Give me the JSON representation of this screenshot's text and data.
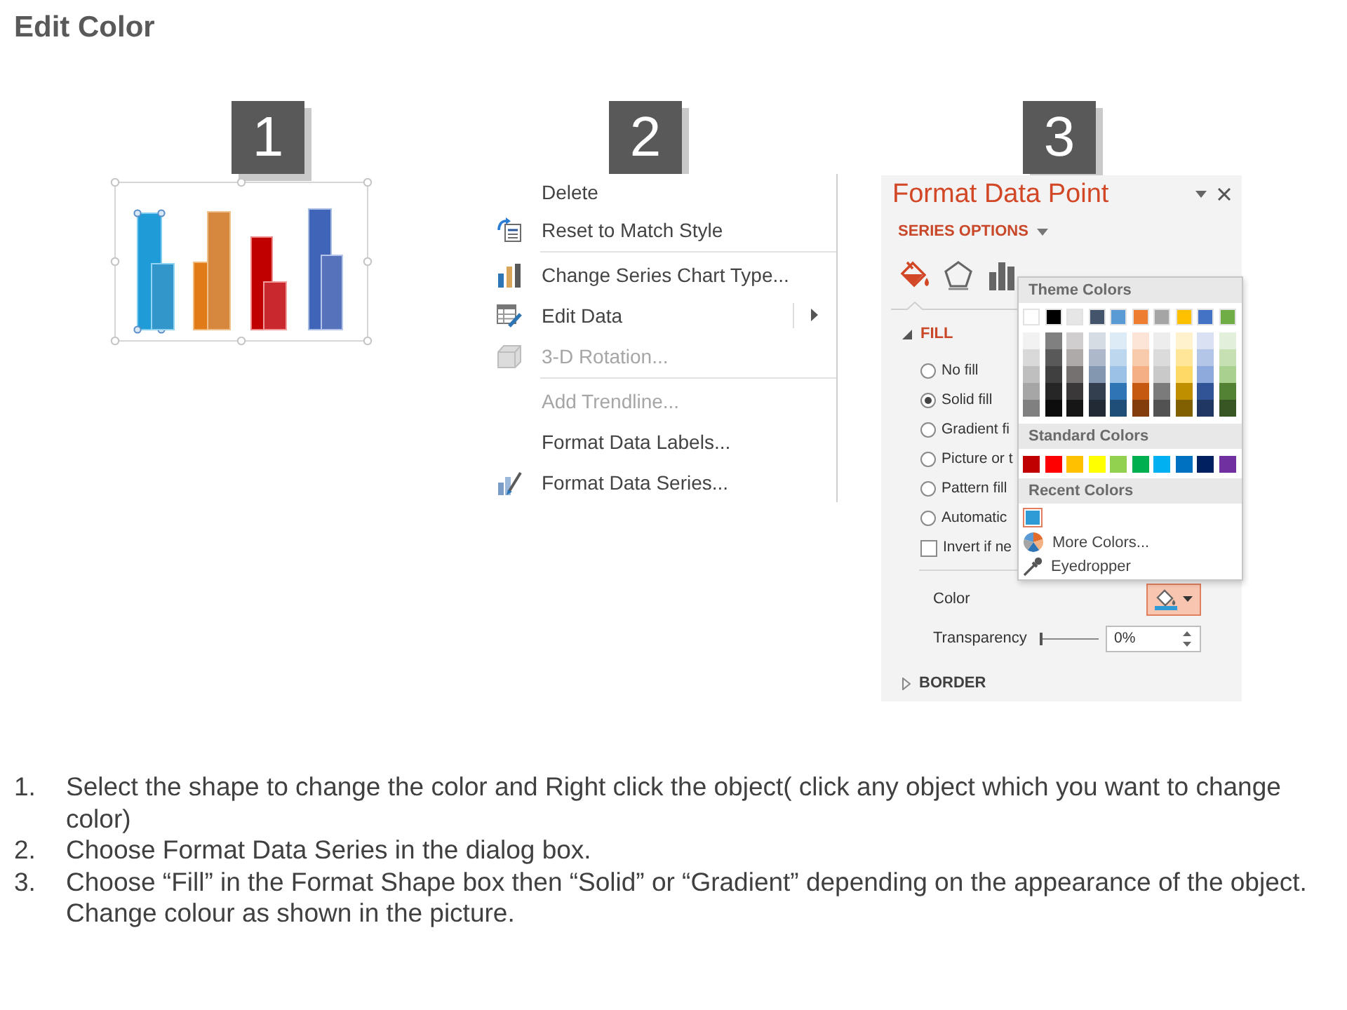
{
  "title": "Edit Color",
  "steps": [
    {
      "badge": "1"
    },
    {
      "badge": "2",
      "context_menu": [
        {
          "kind": "plain",
          "label": "Delete",
          "disabled": false,
          "submenu": false
        },
        {
          "kind": "reset",
          "label": "Reset to Match Style",
          "disabled": false,
          "submenu": false
        },
        {
          "kind": "separator"
        },
        {
          "kind": "chart_type",
          "label": "Change Series Chart Type...",
          "disabled": false,
          "submenu": false
        },
        {
          "kind": "edit_data",
          "label": "Edit Data",
          "disabled": false,
          "submenu": true
        },
        {
          "kind": "rotation",
          "label": "3-D Rotation...",
          "disabled": true,
          "submenu": false
        },
        {
          "kind": "separator"
        },
        {
          "kind": "plain",
          "label": "Add Trendline...",
          "disabled": true,
          "submenu": false
        },
        {
          "kind": "plain",
          "label": "Format Data Labels...",
          "disabled": false,
          "submenu": false
        },
        {
          "kind": "format_series",
          "label": "Format Data Series...",
          "disabled": false,
          "submenu": false
        }
      ]
    },
    {
      "badge": "3",
      "format_pane": {
        "title": "Format Data Point",
        "series_options": "SERIES OPTIONS",
        "tabs": [
          {
            "kind": "fill_line",
            "selected": true
          },
          {
            "kind": "effects",
            "selected": false
          },
          {
            "kind": "series_options",
            "selected": false
          }
        ],
        "sections": [
          {
            "label": "FILL",
            "expanded": true
          },
          {
            "label": "BORDER",
            "expanded": false
          }
        ],
        "fill_options": [
          {
            "label": "No fill",
            "selected": false
          },
          {
            "label": "Solid fill",
            "selected": true
          },
          {
            "label": "Gradient fi",
            "selected": false
          },
          {
            "label": "Picture or t",
            "selected": false
          },
          {
            "label": "Pattern fill",
            "selected": false
          },
          {
            "label": "Automatic",
            "selected": false
          }
        ],
        "invert_if_negative": {
          "label": "Invert if ne",
          "checked": false
        },
        "color": {
          "label": "Color",
          "pressed": true
        },
        "transparency": {
          "label": "Transparency",
          "level": 0,
          "value": "0%"
        },
        "color_menu": {
          "theme_label": "Theme Colors",
          "theme_colors": [
            {
              "color": "#ffffff",
              "shades": [
                {
                  "color": "#f2f2f2"
                },
                {
                  "color": "#d9d9d9"
                },
                {
                  "color": "#bfbfbf"
                },
                {
                  "color": "#a6a6a6"
                },
                {
                  "color": "#808080"
                }
              ]
            },
            {
              "color": "#000000",
              "shades": [
                {
                  "color": "#808080"
                },
                {
                  "color": "#595959"
                },
                {
                  "color": "#404040"
                },
                {
                  "color": "#262626"
                },
                {
                  "color": "#0d0d0d"
                }
              ]
            },
            {
              "color": "#e7e6e6",
              "shades": [
                {
                  "color": "#d0cece"
                },
                {
                  "color": "#aeaaaa"
                },
                {
                  "color": "#757171"
                },
                {
                  "color": "#3a3838"
                },
                {
                  "color": "#171616"
                }
              ]
            },
            {
              "color": "#44546a",
              "shades": [
                {
                  "color": "#d6dce4"
                },
                {
                  "color": "#adb9ca"
                },
                {
                  "color": "#8497b0"
                },
                {
                  "color": "#333f4f"
                },
                {
                  "color": "#222a35"
                }
              ]
            },
            {
              "color": "#5b9bd5",
              "shades": [
                {
                  "color": "#ddebf7"
                },
                {
                  "color": "#bdd7ee"
                },
                {
                  "color": "#9bc2e6"
                },
                {
                  "color": "#2f75b5"
                },
                {
                  "color": "#1f4e78"
                }
              ]
            },
            {
              "color": "#ed7d31",
              "shades": [
                {
                  "color": "#fce4d6"
                },
                {
                  "color": "#f8cbad"
                },
                {
                  "color": "#f4b084"
                },
                {
                  "color": "#c65911"
                },
                {
                  "color": "#833c0c"
                }
              ]
            },
            {
              "color": "#a5a5a5",
              "shades": [
                {
                  "color": "#ededed"
                },
                {
                  "color": "#dbdbdb"
                },
                {
                  "color": "#c9c9c9"
                },
                {
                  "color": "#7b7b7b"
                },
                {
                  "color": "#525252"
                }
              ]
            },
            {
              "color": "#ffc000",
              "shades": [
                {
                  "color": "#fff2cc"
                },
                {
                  "color": "#ffe699"
                },
                {
                  "color": "#ffd966"
                },
                {
                  "color": "#bf8f00"
                },
                {
                  "color": "#806000"
                }
              ]
            },
            {
              "color": "#4472c4",
              "shades": [
                {
                  "color": "#d9e1f2"
                },
                {
                  "color": "#b4c6e7"
                },
                {
                  "color": "#8ea9db"
                },
                {
                  "color": "#305496"
                },
                {
                  "color": "#203764"
                }
              ]
            },
            {
              "color": "#70ad47",
              "shades": [
                {
                  "color": "#e2efda"
                },
                {
                  "color": "#c6e0b4"
                },
                {
                  "color": "#a9d08e"
                },
                {
                  "color": "#548235"
                },
                {
                  "color": "#375623"
                }
              ]
            }
          ],
          "standard_label": "Standard Colors",
          "standard_colors": [
            {
              "color": "#c00000"
            },
            {
              "color": "#ff0000"
            },
            {
              "color": "#ffc000"
            },
            {
              "color": "#ffff00"
            },
            {
              "color": "#92d050"
            },
            {
              "color": "#00b050"
            },
            {
              "color": "#00b0f0"
            },
            {
              "color": "#0070c0"
            },
            {
              "color": "#002060"
            },
            {
              "color": "#7030a0"
            }
          ],
          "recent_label": "Recent Colors",
          "recent_colors": [
            {
              "color": "#2e9bd6",
              "selected": true
            }
          ],
          "more_colors": "More Colors...",
          "eyedropper": "Eyedropper"
        }
      }
    }
  ],
  "instructions": [
    {
      "number": "1.",
      "text": "Select the shape to change the color and Right click the object( click any object which you want to change color)"
    },
    {
      "number": "2.",
      "text": "Choose Format Data Series in the dialog box."
    },
    {
      "number": "3.",
      "text": "Choose “Fill” in the Format Shape box then “Solid” or “Gradient” depending on the appearance of the object. Change colour as shown in the picture."
    }
  ]
}
